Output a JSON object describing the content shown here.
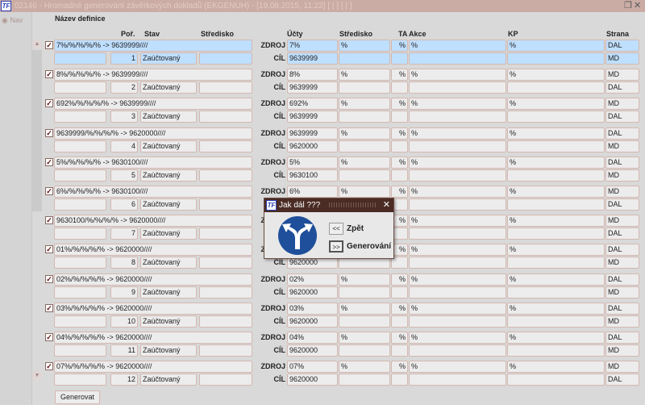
{
  "window": {
    "title": "02146 - Hromadné generování závěrkových dokladů (EKGENUH) - [19.08.2015, 11:22] [ | ] [ | ]",
    "logo": "TF"
  },
  "nav": {
    "label": "Nav"
  },
  "headers": {
    "nazev": "Název definice",
    "por": "Poř.",
    "stav": "Stav",
    "stredisko": "Středisko",
    "ucty": "Účty",
    "stredisko2": "Středisko",
    "ta": "TA",
    "akce": "Akce",
    "kp": "KP",
    "strana": "Strana"
  },
  "labels": {
    "zdroj": "ZDROJ",
    "cil": "CÍL"
  },
  "rows": [
    {
      "name": "7%/%/%/%/% -> 9639999////",
      "por": "1",
      "stav": "Zaúčtovaný",
      "zdroj": "7%",
      "cil": "9639999",
      "stred": "%",
      "ta": "%",
      "akce": "%",
      "kp": "%",
      "strana_zdroj": "DAL",
      "strana_cil": "MD",
      "selected": true
    },
    {
      "name": "8%/%/%/%/% -> 9639999////",
      "por": "2",
      "stav": "Zaúčtovaný",
      "zdroj": "8%",
      "cil": "9639999",
      "stred": "%",
      "ta": "%",
      "akce": "%",
      "kp": "%",
      "strana_zdroj": "MD",
      "strana_cil": "DAL"
    },
    {
      "name": "692%/%/%/%/% -> 9639999////",
      "por": "3",
      "stav": "Zaúčtovaný",
      "zdroj": "692%",
      "cil": "9639999",
      "stred": "%",
      "ta": "%",
      "akce": "%",
      "kp": "%",
      "strana_zdroj": "MD",
      "strana_cil": "DAL"
    },
    {
      "name": "9639999/%/%/%/% -> 9620000////",
      "por": "4",
      "stav": "Zaúčtovaný",
      "zdroj": "9639999",
      "cil": "9620000",
      "stred": "%",
      "ta": "%",
      "akce": "%",
      "kp": "%",
      "strana_zdroj": "DAL",
      "strana_cil": "MD"
    },
    {
      "name": "5%/%/%/%/% -> 9630100////",
      "por": "5",
      "stav": "Zaúčtovaný",
      "zdroj": "5%",
      "cil": "9630100",
      "stred": "%",
      "ta": "%",
      "akce": "%",
      "kp": "%",
      "strana_zdroj": "DAL",
      "strana_cil": "MD"
    },
    {
      "name": "6%/%/%/%/% -> 9630100////",
      "por": "6",
      "stav": "Zaúčtovaný",
      "zdroj": "6%",
      "cil": "",
      "stred": "%",
      "ta": "%",
      "akce": "%",
      "kp": "%",
      "strana_zdroj": "MD",
      "strana_cil": "DAL"
    },
    {
      "name": "9630100/%/%/%/% -> 9620000////",
      "por": "7",
      "stav": "Zaúčtovaný",
      "zdroj": "",
      "cil": "",
      "stred": "%",
      "ta": "%",
      "akce": "%",
      "kp": "%",
      "strana_zdroj": "MD",
      "strana_cil": "DAL"
    },
    {
      "name": "01%/%/%/%/% -> 9620000////",
      "por": "8",
      "stav": "Zaúčtovaný",
      "zdroj": "",
      "cil": "9620000",
      "stred": "%",
      "ta": "%",
      "akce": "%",
      "kp": "%",
      "strana_zdroj": "DAL",
      "strana_cil": "MD"
    },
    {
      "name": "02%/%/%/%/% -> 9620000////",
      "por": "9",
      "stav": "Zaúčtovaný",
      "zdroj": "02%",
      "cil": "9620000",
      "stred": "%",
      "ta": "%",
      "akce": "%",
      "kp": "%",
      "strana_zdroj": "DAL",
      "strana_cil": "MD"
    },
    {
      "name": "03%/%/%/%/% -> 9620000////",
      "por": "10",
      "stav": "Zaúčtovaný",
      "zdroj": "03%",
      "cil": "9620000",
      "stred": "%",
      "ta": "%",
      "akce": "%",
      "kp": "%",
      "strana_zdroj": "DAL",
      "strana_cil": "MD"
    },
    {
      "name": "04%/%/%/%/% -> 9620000////",
      "por": "11",
      "stav": "Zaúčtovaný",
      "zdroj": "04%",
      "cil": "9620000",
      "stred": "%",
      "ta": "%",
      "akce": "%",
      "kp": "%",
      "strana_zdroj": "DAL",
      "strana_cil": "MD"
    },
    {
      "name": "07%/%/%/%/% -> 9620000////",
      "por": "12",
      "stav": "Zaúčtovaný",
      "zdroj": "07%",
      "cil": "9620000",
      "stred": "%",
      "ta": "%",
      "akce": "%",
      "kp": "%",
      "strana_zdroj": "MD",
      "strana_cil": "DAL"
    }
  ],
  "footer": {
    "generovat": "Generovat"
  },
  "dialog": {
    "title": "Jak dál ???",
    "back_btn": "<<",
    "back_label": "Zpět",
    "gen_btn": ">>",
    "gen_label": "Generování",
    "icon_color": "#1f4f9a"
  }
}
